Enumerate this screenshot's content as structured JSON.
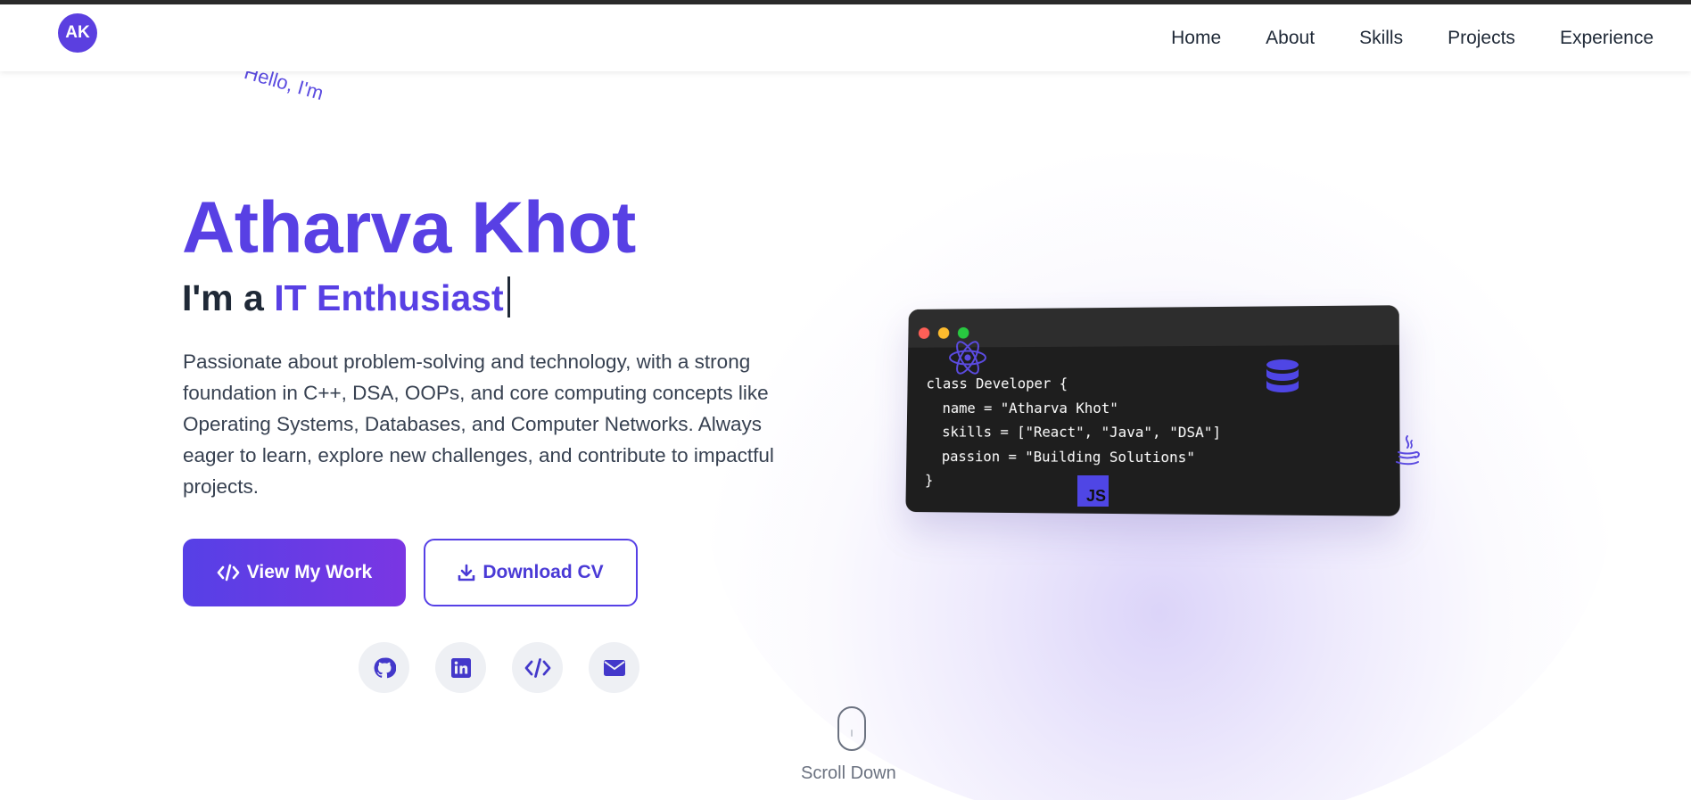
{
  "header": {
    "logo_text": "AK",
    "nav": [
      "Home",
      "About",
      "Skills",
      "Projects",
      "Experience"
    ]
  },
  "hero": {
    "greeting": "Hello, I'm",
    "name": "Atharva Khot",
    "role_prefix": "I'm a",
    "role_highlight": "IT Enthusiast",
    "description": "Passionate about problem-solving and technology, with a strong foundation in C++, DSA, OOPs, and core computing concepts like Operating Systems, Databases, and Computer Networks. Always eager to learn, explore new challenges, and contribute to impactful projects.",
    "primary_button": "View My Work",
    "secondary_button": "Download CV",
    "social_icons": [
      "github-icon",
      "linkedin-icon",
      "code-icon",
      "envelope-icon"
    ]
  },
  "code_window": {
    "lines": [
      "class Developer {",
      "  name = \"Atharva Khot\"",
      "  skills = [\"React\", \"Java\", \"DSA\"]",
      "  passion = \"Building Solutions\"",
      "}"
    ],
    "floating_icons": [
      "react-icon",
      "database-icon",
      "javascript-icon",
      "java-icon"
    ],
    "js_badge": "JS"
  },
  "scroll_hint": "Scroll Down",
  "colors": {
    "accent": "#5840e4",
    "gradient_end": "#7a36e3",
    "code_bg": "#1e1e1e"
  }
}
